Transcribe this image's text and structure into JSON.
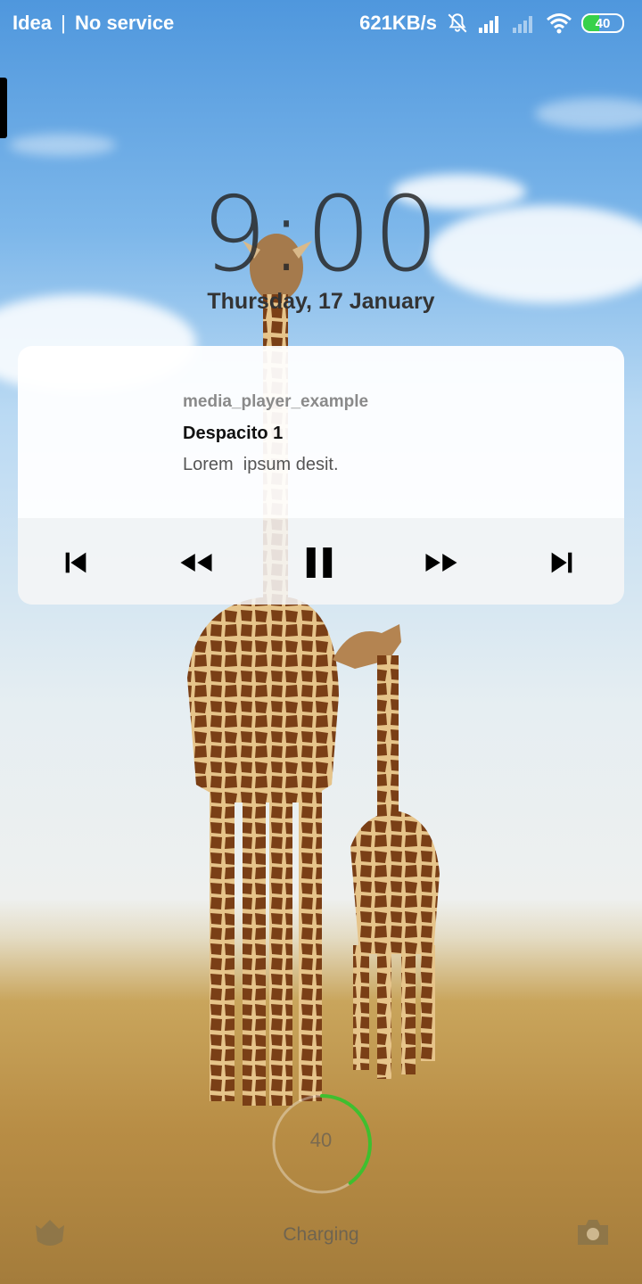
{
  "status_bar": {
    "carrier": "Idea",
    "separator": "|",
    "service": "No service",
    "network_speed": "621KB/s",
    "battery_level": "40",
    "icons": [
      "bell-off-icon",
      "signal-icon",
      "signal-weak-icon",
      "wifi-icon",
      "battery-icon"
    ],
    "battery_color": "#38d14a"
  },
  "lockscreen": {
    "time": "9:00",
    "date": "Thursday, 17 January"
  },
  "media_notification": {
    "app_name": "media_player_example",
    "title": "Despacito 1",
    "subtitle": "Lorem  ipsum desit.",
    "controls": [
      "skip-previous-icon",
      "rewind-icon",
      "pause-icon",
      "fast-forward-icon",
      "skip-next-icon"
    ]
  },
  "charging": {
    "level": "40",
    "label": "Charging",
    "ring_color": "#3fbf2f"
  },
  "shortcuts": [
    "app-shortcut-icon",
    "camera-icon"
  ]
}
